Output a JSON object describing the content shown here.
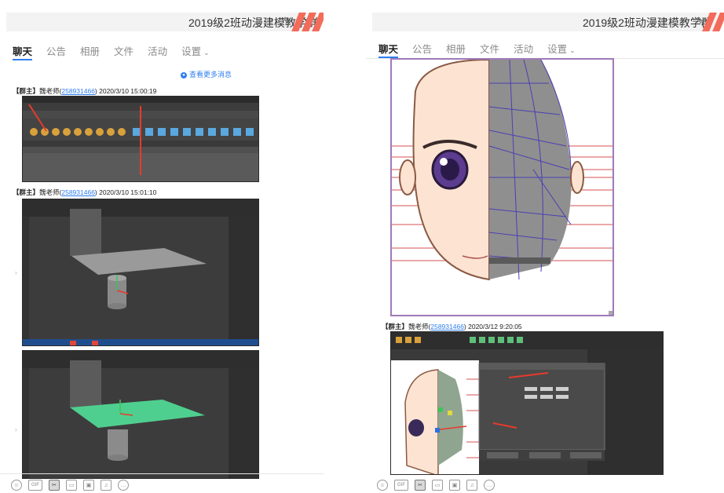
{
  "left": {
    "title": "2019级2班动漫建模教学群",
    "tabs": [
      "聊天",
      "公告",
      "相册",
      "文件",
      "活动",
      "设置"
    ],
    "more_messages": "查看更多消息",
    "messages": [
      {
        "role": "【群主】",
        "sender": "魏老师",
        "qq": "258931466",
        "time": "2020/3/10 15:00:19"
      },
      {
        "role": "【群主】",
        "sender": "魏老师",
        "qq": "258931466",
        "time": "2020/3/10 15:01:10"
      }
    ]
  },
  "right": {
    "title": "2019级2班动漫建模教学群",
    "tabs": [
      "聊天",
      "公告",
      "相册",
      "文件",
      "活动",
      "设置"
    ],
    "messages": [
      {
        "role": "【群主】",
        "sender": "魏老师",
        "qq": "258931466",
        "time": "2020/3/12 9:20:05"
      }
    ]
  },
  "paren_open": "(",
  "paren_close": ")",
  "edit_icon": "pencil-icon",
  "colors": {
    "accent": "#2f7ff0",
    "stripe": "#f26b5b",
    "maya_dark": "#3a3a3a",
    "plane_green": "#4fcf8f"
  }
}
